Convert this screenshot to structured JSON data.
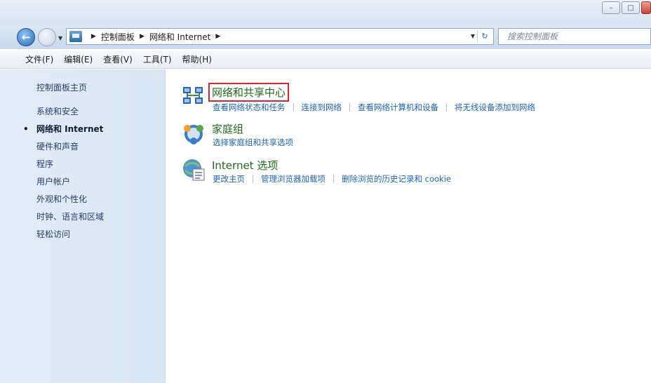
{
  "address": {
    "crumbs": [
      "控制面板",
      "网络和 Internet"
    ]
  },
  "search": {
    "placeholder": "搜索控制面板"
  },
  "menu": [
    "文件(F)",
    "编辑(E)",
    "查看(V)",
    "工具(T)",
    "帮助(H)"
  ],
  "sidebar": {
    "home": "控制面板主页",
    "items": [
      {
        "label": "系统和安全",
        "active": false
      },
      {
        "label": "网络和 Internet",
        "active": true
      },
      {
        "label": "硬件和声音",
        "active": false
      },
      {
        "label": "程序",
        "active": false
      },
      {
        "label": "用户帐户",
        "active": false
      },
      {
        "label": "外观和个性化",
        "active": false
      },
      {
        "label": "时钟、语言和区域",
        "active": false
      },
      {
        "label": "轻松访问",
        "active": false
      }
    ]
  },
  "categories": [
    {
      "title": "网络和共享中心",
      "icon": "network-sharing-icon",
      "highlighted": true,
      "links": [
        "查看网络状态和任务",
        "连接到网络",
        "查看网络计算机和设备",
        "将无线设备添加到网络"
      ]
    },
    {
      "title": "家庭组",
      "icon": "homegroup-icon",
      "highlighted": false,
      "links": [
        "选择家庭组和共享选项"
      ]
    },
    {
      "title": "Internet 选项",
      "icon": "internet-options-icon",
      "highlighted": false,
      "links": [
        "更改主页",
        "管理浏览器加载项",
        "删除浏览的历史记录和 cookie"
      ]
    }
  ],
  "colors": {
    "category_title": "#1e6a1e",
    "link": "#1b62b2",
    "highlight_box": "#d7262e",
    "sidebar_bg": "#dfe9f5"
  }
}
